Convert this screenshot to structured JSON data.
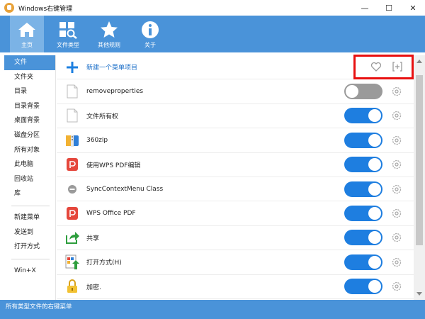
{
  "window": {
    "title": "Windows右键管理",
    "minimize": "—",
    "maximize": "☐",
    "close": "✕"
  },
  "toolbar": {
    "items": [
      {
        "label": "主页",
        "icon": "home-icon"
      },
      {
        "label": "文件类型",
        "icon": "file-types-icon"
      },
      {
        "label": "其他规则",
        "icon": "star-icon"
      },
      {
        "label": "关于",
        "icon": "info-icon"
      }
    ]
  },
  "sidebar": {
    "items": [
      "文件",
      "文件夹",
      "目录",
      "目录背景",
      "桌面背景",
      "磁盘分区",
      "所有对象",
      "此电脑",
      "回收站",
      "库",
      "新建菜单",
      "发送到",
      "打开方式",
      "Win+X"
    ]
  },
  "main": {
    "new_item_label": "新建一个菜单项目",
    "rows": [
      {
        "label": "removeproperties",
        "enabled": false,
        "icon": "blank-file-icon"
      },
      {
        "label": "文件所有权",
        "enabled": true,
        "icon": "blank-file-icon"
      },
      {
        "label": "360zip",
        "enabled": true,
        "icon": "360zip-icon"
      },
      {
        "label": "使用WPS PDF编辑",
        "enabled": true,
        "icon": "wps-pdf-icon"
      },
      {
        "label": "SyncContextMenu Class",
        "enabled": true,
        "icon": "disabled-circle-icon"
      },
      {
        "label": "WPS Office PDF",
        "enabled": true,
        "icon": "wps-pdf-icon"
      },
      {
        "label": "共享",
        "enabled": true,
        "icon": "share-icon"
      },
      {
        "label": "打开方式(H)",
        "enabled": true,
        "icon": "open-with-icon"
      },
      {
        "label": "加密.",
        "enabled": true,
        "icon": "lock-icon"
      }
    ]
  },
  "statusbar": {
    "text": "所有类型文件的右键菜单"
  },
  "colors": {
    "accent": "#4a93d9",
    "toggle_on": "#1e7ee0",
    "toggle_off": "#9a9a9a",
    "highlight": "#e81010"
  }
}
